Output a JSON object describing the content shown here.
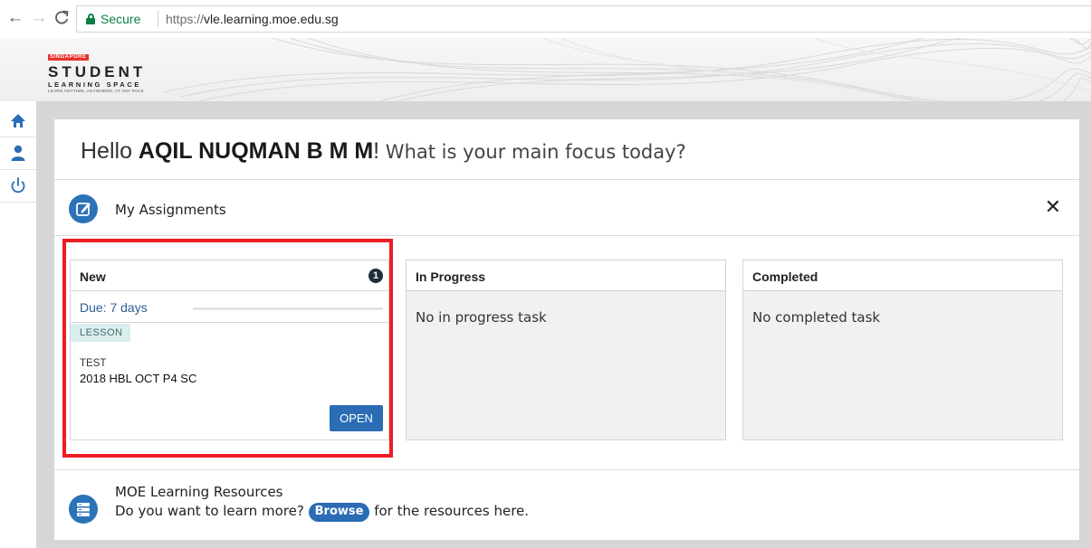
{
  "browser": {
    "secure_label": "Secure",
    "url_scheme": "https://",
    "url_host": "vle.learning.moe.edu.sg",
    "icons": [
      "back-arrow-icon",
      "forward-arrow-icon",
      "reload-icon",
      "lock-icon"
    ]
  },
  "logo": {
    "tag": "SINGAPORE",
    "main": "STUDENT",
    "sub": "LEARNING SPACE",
    "tagline": "LEARN ANYTIME, ANYWHERE, AT ANY PACE"
  },
  "rail": {
    "items": [
      {
        "icon": "home-icon"
      },
      {
        "icon": "user-icon"
      },
      {
        "icon": "power-icon"
      }
    ]
  },
  "greeting": {
    "prefix": "Hello ",
    "name": "AQIL NUQMAN B M M",
    "exclaim": "!",
    "question": " What is your main focus today?"
  },
  "assignments": {
    "title": "My Assignments",
    "close_symbol": "✕",
    "columns": {
      "new": {
        "title": "New",
        "count": "1",
        "task": {
          "due": "Due: 7 days",
          "due_progress": 0,
          "tag": "LESSON",
          "type": "TEST",
          "title": "2018 HBL OCT P4 SC",
          "open_label": "OPEN"
        }
      },
      "in_progress": {
        "title": "In Progress",
        "empty_text": "No in progress task"
      },
      "completed": {
        "title": "Completed",
        "empty_text": "No completed task"
      }
    }
  },
  "resources": {
    "title": "MOE Learning Resources",
    "text_before": "Do you want to learn more? ",
    "browse_label": "Browse",
    "text_after": " for the resources here."
  },
  "colors": {
    "accent_blue": "#2b6cb5",
    "highlight_red": "#ee1c24",
    "secure_green": "#0b8043",
    "frame_grey": "#d6d6d6"
  }
}
